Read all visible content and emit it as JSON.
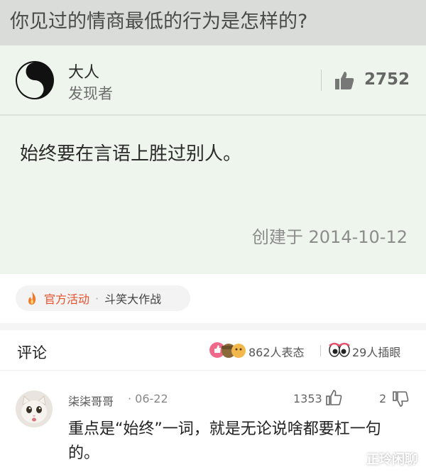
{
  "question": {
    "title": "你见过的情商最低的行为是怎样的?"
  },
  "answer": {
    "author_name": "大人",
    "author_title": "发现者",
    "like_count": "2752",
    "text": "始终要在言语上胜过别人。",
    "created": "创建于 2014-10-12"
  },
  "activity": {
    "label": "官方活动",
    "separator": "·",
    "name": "斗笑大作战"
  },
  "comments_header": {
    "title": "评论",
    "reactions": "862人表态",
    "eyes": "29人插眼"
  },
  "comment": {
    "user": "柒柒哥哥",
    "date": "· 06-22",
    "up_count": "1353",
    "down_count": "2",
    "text": "重点是“始终”一词，就是无论说啥都要杠一句的。"
  },
  "watermark": "正玲闲聊",
  "icons": {
    "avatar": "yin-yang-icon",
    "like": "thumbs-up-icon",
    "fire": "fire-icon",
    "reactions": "reaction-emoji-icon",
    "eyes": "eyes-icon",
    "up": "thumbs-up-outline-icon",
    "down": "thumbs-down-outline-icon"
  },
  "colors": {
    "card_bg": "#eef5ec",
    "question_bg": "#d9dcd9",
    "accent": "#e8522d"
  }
}
